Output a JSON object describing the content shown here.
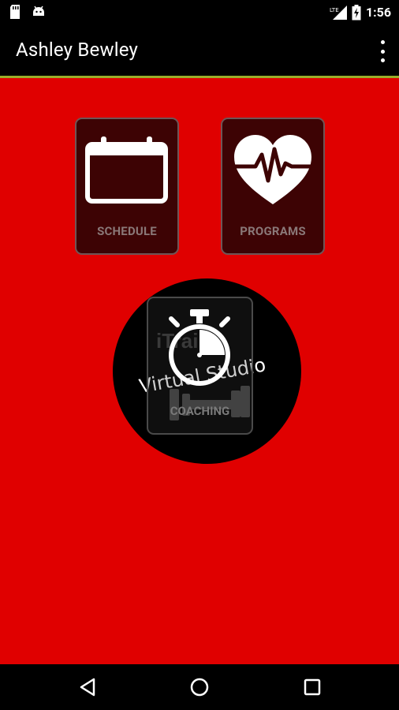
{
  "status_bar": {
    "time": "1:56",
    "network": "LTE"
  },
  "app_bar": {
    "title": "Ashley Bewley"
  },
  "tiles": {
    "schedule_label": "SCHEDULE",
    "programs_label": "PROGRAMS",
    "coaching_label": "COACHING"
  },
  "logo": {
    "brand_text": "iTrain",
    "tagline": "Virtual Studio"
  },
  "colors": {
    "background": "#e00000",
    "tile_bg": "#3d0304",
    "app_bar_accent": "#9aad2a"
  },
  "icons": {
    "schedule": "calendar-icon",
    "programs": "heart-pulse-icon",
    "coaching": "stopwatch-icon"
  }
}
